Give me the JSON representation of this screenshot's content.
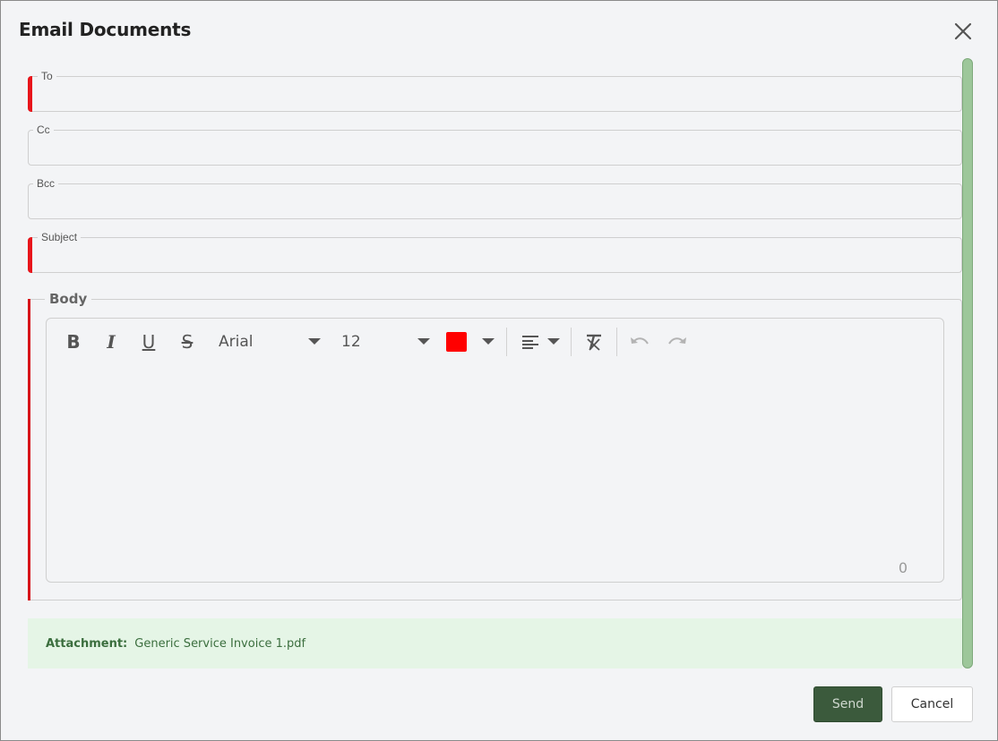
{
  "dialog": {
    "title": "Email Documents",
    "close_icon": "close-icon"
  },
  "fields": {
    "to": {
      "label": "To",
      "value": "",
      "required": true
    },
    "cc": {
      "label": "Cc",
      "value": "",
      "required": false
    },
    "bcc": {
      "label": "Bcc",
      "value": "",
      "required": false
    },
    "subject": {
      "label": "Subject",
      "value": "",
      "required": true
    }
  },
  "body": {
    "legend": "Body",
    "toolbar": {
      "bold": "B",
      "italic": "I",
      "underline": "U",
      "strikethrough": "S",
      "font_family": "Arial",
      "font_size": "12",
      "text_color": "#ff0000",
      "align_icon": "align-left-icon",
      "clear_format_icon": "clear-format-icon",
      "undo_icon": "undo-icon",
      "redo_icon": "redo-icon"
    },
    "content": "",
    "char_count": "0"
  },
  "attachment": {
    "label": "Attachment:",
    "filename": "Generic Service Invoice 1.pdf"
  },
  "actions": {
    "send": "Send",
    "cancel": "Cancel"
  },
  "colors": {
    "required_marker": "#e8151b",
    "scrollbar": "#9dc79a",
    "attachment_bg": "#e5f5e6",
    "send_bg": "#3b5a3c"
  }
}
